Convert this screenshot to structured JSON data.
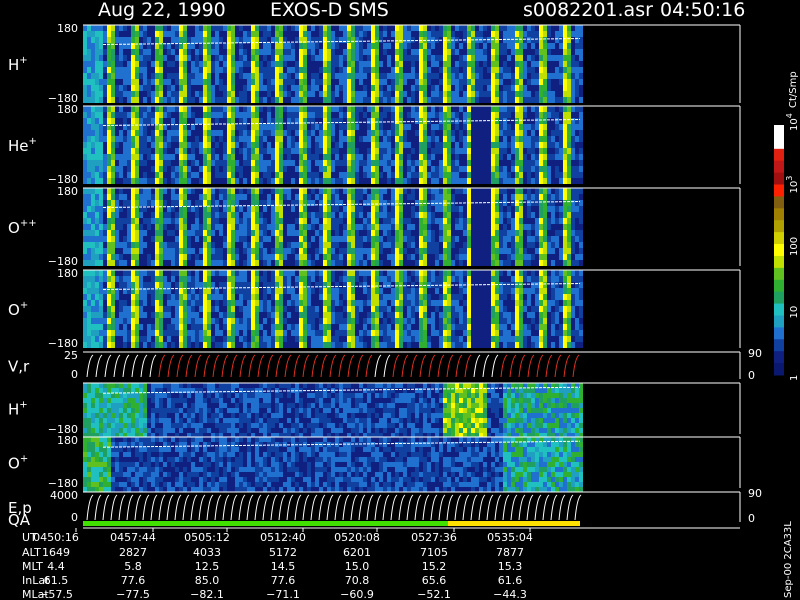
{
  "header": {
    "date": "Aug 22, 1990",
    "instrument": "EXOS-D SMS",
    "file": "s0082201.asr",
    "start_time": "04:50:16"
  },
  "chart_data": {
    "type": "heatmap",
    "panels": [
      {
        "id": "hplus_angle",
        "label": "H",
        "sup": "+",
        "ymax": "180",
        "ymin": "−180"
      },
      {
        "id": "heplus_angle",
        "label": "He",
        "sup": "+",
        "ymax": "180",
        "ymin": "−180"
      },
      {
        "id": "oplusplus_angle",
        "label": "O",
        "sup": "++",
        "ymax": "180",
        "ymin": "−180"
      },
      {
        "id": "oplus_angle",
        "label": "O",
        "sup": "+",
        "ymax": "180",
        "ymin": "−180"
      },
      {
        "id": "vr",
        "label": "V,r",
        "sup": "",
        "ymax": "25",
        "ymin": "0",
        "right_top": "90",
        "right_bottom": "0"
      },
      {
        "id": "hplus_energy",
        "label": "H",
        "sup": "+",
        "ymax": "",
        "ymin": "−180"
      },
      {
        "id": "oplus_energy",
        "label": "O",
        "sup": "+",
        "ymax": "180",
        "ymin": "−180"
      },
      {
        "id": "ep",
        "label": "E,p",
        "sup": "",
        "ymax": "4000",
        "ymin": "0",
        "right_top": "90",
        "right_bottom": "0"
      }
    ],
    "qa_label": "QA",
    "colorbar": {
      "unit": "Ct/Smp",
      "ticks": [
        {
          "label": "10",
          "sup": "4",
          "value": 10000
        },
        {
          "label": "10",
          "sup": "3",
          "value": 1000
        },
        {
          "label": "100",
          "sup": "",
          "value": 100
        },
        {
          "label": "10",
          "sup": "",
          "value": 10
        },
        {
          "label": "1",
          "sup": "",
          "value": 1
        }
      ],
      "colors": [
        "#ffffff",
        "#ffffff",
        "#e02010",
        "#c01818",
        "#a01010",
        "#ff2000",
        "#806010",
        "#a08000",
        "#b0a000",
        "#d0d000",
        "#ffff00",
        "#c0e000",
        "#60c020",
        "#30b030",
        "#20a060",
        "#20c0c0",
        "#20a0c0",
        "#2070d0",
        "#1040a0",
        "#102080",
        "#0a1870"
      ]
    },
    "time_axis": {
      "labels": [
        "UT",
        "ALT",
        "MLT",
        "InLat",
        "MLat"
      ],
      "columns": [
        {
          "UT": "0450:16",
          "ALT": "1649",
          "MLT": "4.4",
          "InLat": "61.5",
          "MLat": "−57.5"
        },
        {
          "UT": "0457:44",
          "ALT": "2827",
          "MLT": "5.8",
          "InLat": "77.6",
          "MLat": "−77.5"
        },
        {
          "UT": "0505:12",
          "ALT": "4033",
          "MLT": "12.5",
          "InLat": "85.0",
          "MLat": "−82.1"
        },
        {
          "UT": "0512:40",
          "ALT": "5172",
          "MLT": "14.5",
          "InLat": "77.6",
          "MLat": "−71.1"
        },
        {
          "UT": "0520:08",
          "ALT": "6201",
          "MLT": "15.0",
          "InLat": "70.8",
          "MLat": "−60.9"
        },
        {
          "UT": "0527:36",
          "ALT": "7105",
          "MLT": "15.2",
          "InLat": "65.6",
          "MLat": "−52.1"
        },
        {
          "UT": "0535:04",
          "ALT": "7877",
          "MLT": "15.3",
          "InLat": "61.6",
          "MLat": "−44.3"
        }
      ]
    },
    "footer": "Sep-00  2CA33L"
  }
}
